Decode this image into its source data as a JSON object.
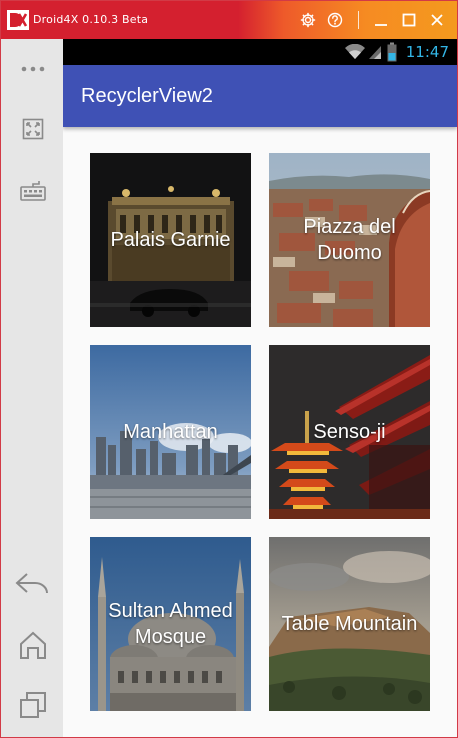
{
  "window": {
    "title": "Droid4X 0.10.3 Beta",
    "accent_color": "#d4202f",
    "buttons": [
      "gear-icon",
      "help-icon",
      "minimize-icon",
      "maximize-icon",
      "close-icon"
    ]
  },
  "sidepanel": {
    "items": [
      "more-icon",
      "fullscreen-icon",
      "keyboard-icon",
      "back-icon",
      "home-icon",
      "recent-apps-icon"
    ]
  },
  "statusbar": {
    "time": "11:47",
    "icons": [
      "wifi-icon",
      "signal-icon",
      "battery-icon"
    ]
  },
  "appbar": {
    "title": "RecyclerView2",
    "color": "#3f51b5"
  },
  "grid": {
    "items": [
      {
        "label": "Palais Garnie"
      },
      {
        "label": "Piazza del Duomo"
      },
      {
        "label": "Manhattan"
      },
      {
        "label": "Senso-ji"
      },
      {
        "label": "Sultan Ahmed Mosque"
      },
      {
        "label": "Table Mountain"
      }
    ]
  }
}
